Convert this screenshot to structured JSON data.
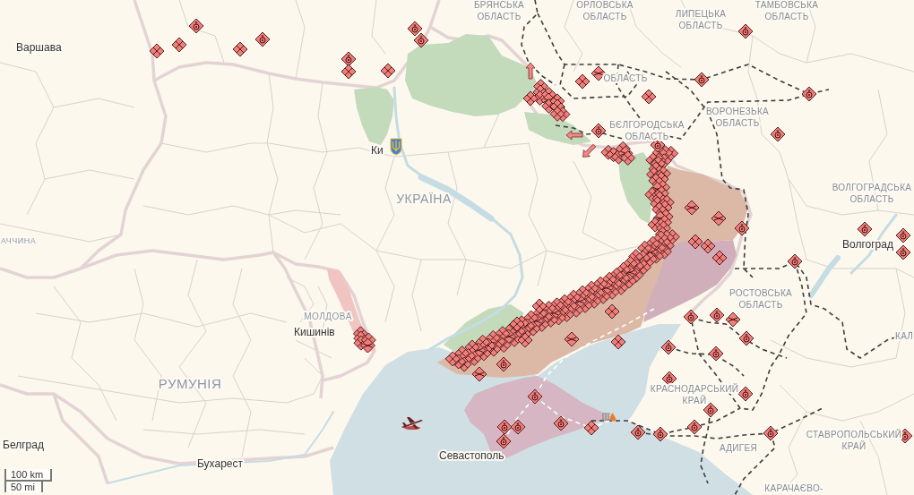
{
  "map": {
    "countries": [
      "УКРАЇНА",
      "АЧЧИНА",
      "МОЛДОВА",
      "РУМУНІЯ"
    ],
    "regions": [
      {
        "lines": [
          "БРЯНСЬКА",
          "ОБЛАСТЬ"
        ]
      },
      {
        "lines": [
          "ОРЛОВСЬКА",
          "ОБЛАСТЬ"
        ]
      },
      {
        "lines": [
          "ЛИПЕЦЬКА",
          "ОБЛАСТЬ"
        ]
      },
      {
        "lines": [
          "ТАМБОВСЬКА",
          "ОБЛАСТЬ"
        ]
      },
      {
        "lines": [
          "ОБЛАСТЬ"
        ]
      },
      {
        "lines": [
          "ВОРОНЕЗЬКА",
          "ОБЛАСТЬ"
        ]
      },
      {
        "lines": [
          "БЄЛГОРОДСЬКА",
          "ОБЛАСТЬ"
        ]
      },
      {
        "lines": [
          "ВОЛГОГРАДСЬКА",
          "ОБЛАСТЬ"
        ]
      },
      {
        "lines": [
          "РОСТОВСЬКА",
          "ОБЛАСТЬ"
        ]
      },
      {
        "lines": [
          "КАЛ"
        ]
      },
      {
        "lines": [
          "КРАСНОДАРСЬКИЙ",
          "КРАЙ"
        ]
      },
      {
        "lines": [
          "СТАВРОПОЛЬСЬКИЙ",
          "КРАЙ"
        ]
      },
      {
        "lines": [
          "АДИГЕЯ"
        ]
      },
      {
        "lines": [
          "КАРАЧАЄВО-"
        ]
      }
    ],
    "cities": [
      "Варшава",
      "Ки",
      "Волгоград",
      "Кишинів",
      "Белград",
      "Бухарест",
      "Севастополь"
    ]
  },
  "scale": {
    "metric": "100 km",
    "imperial": "50 mi"
  }
}
